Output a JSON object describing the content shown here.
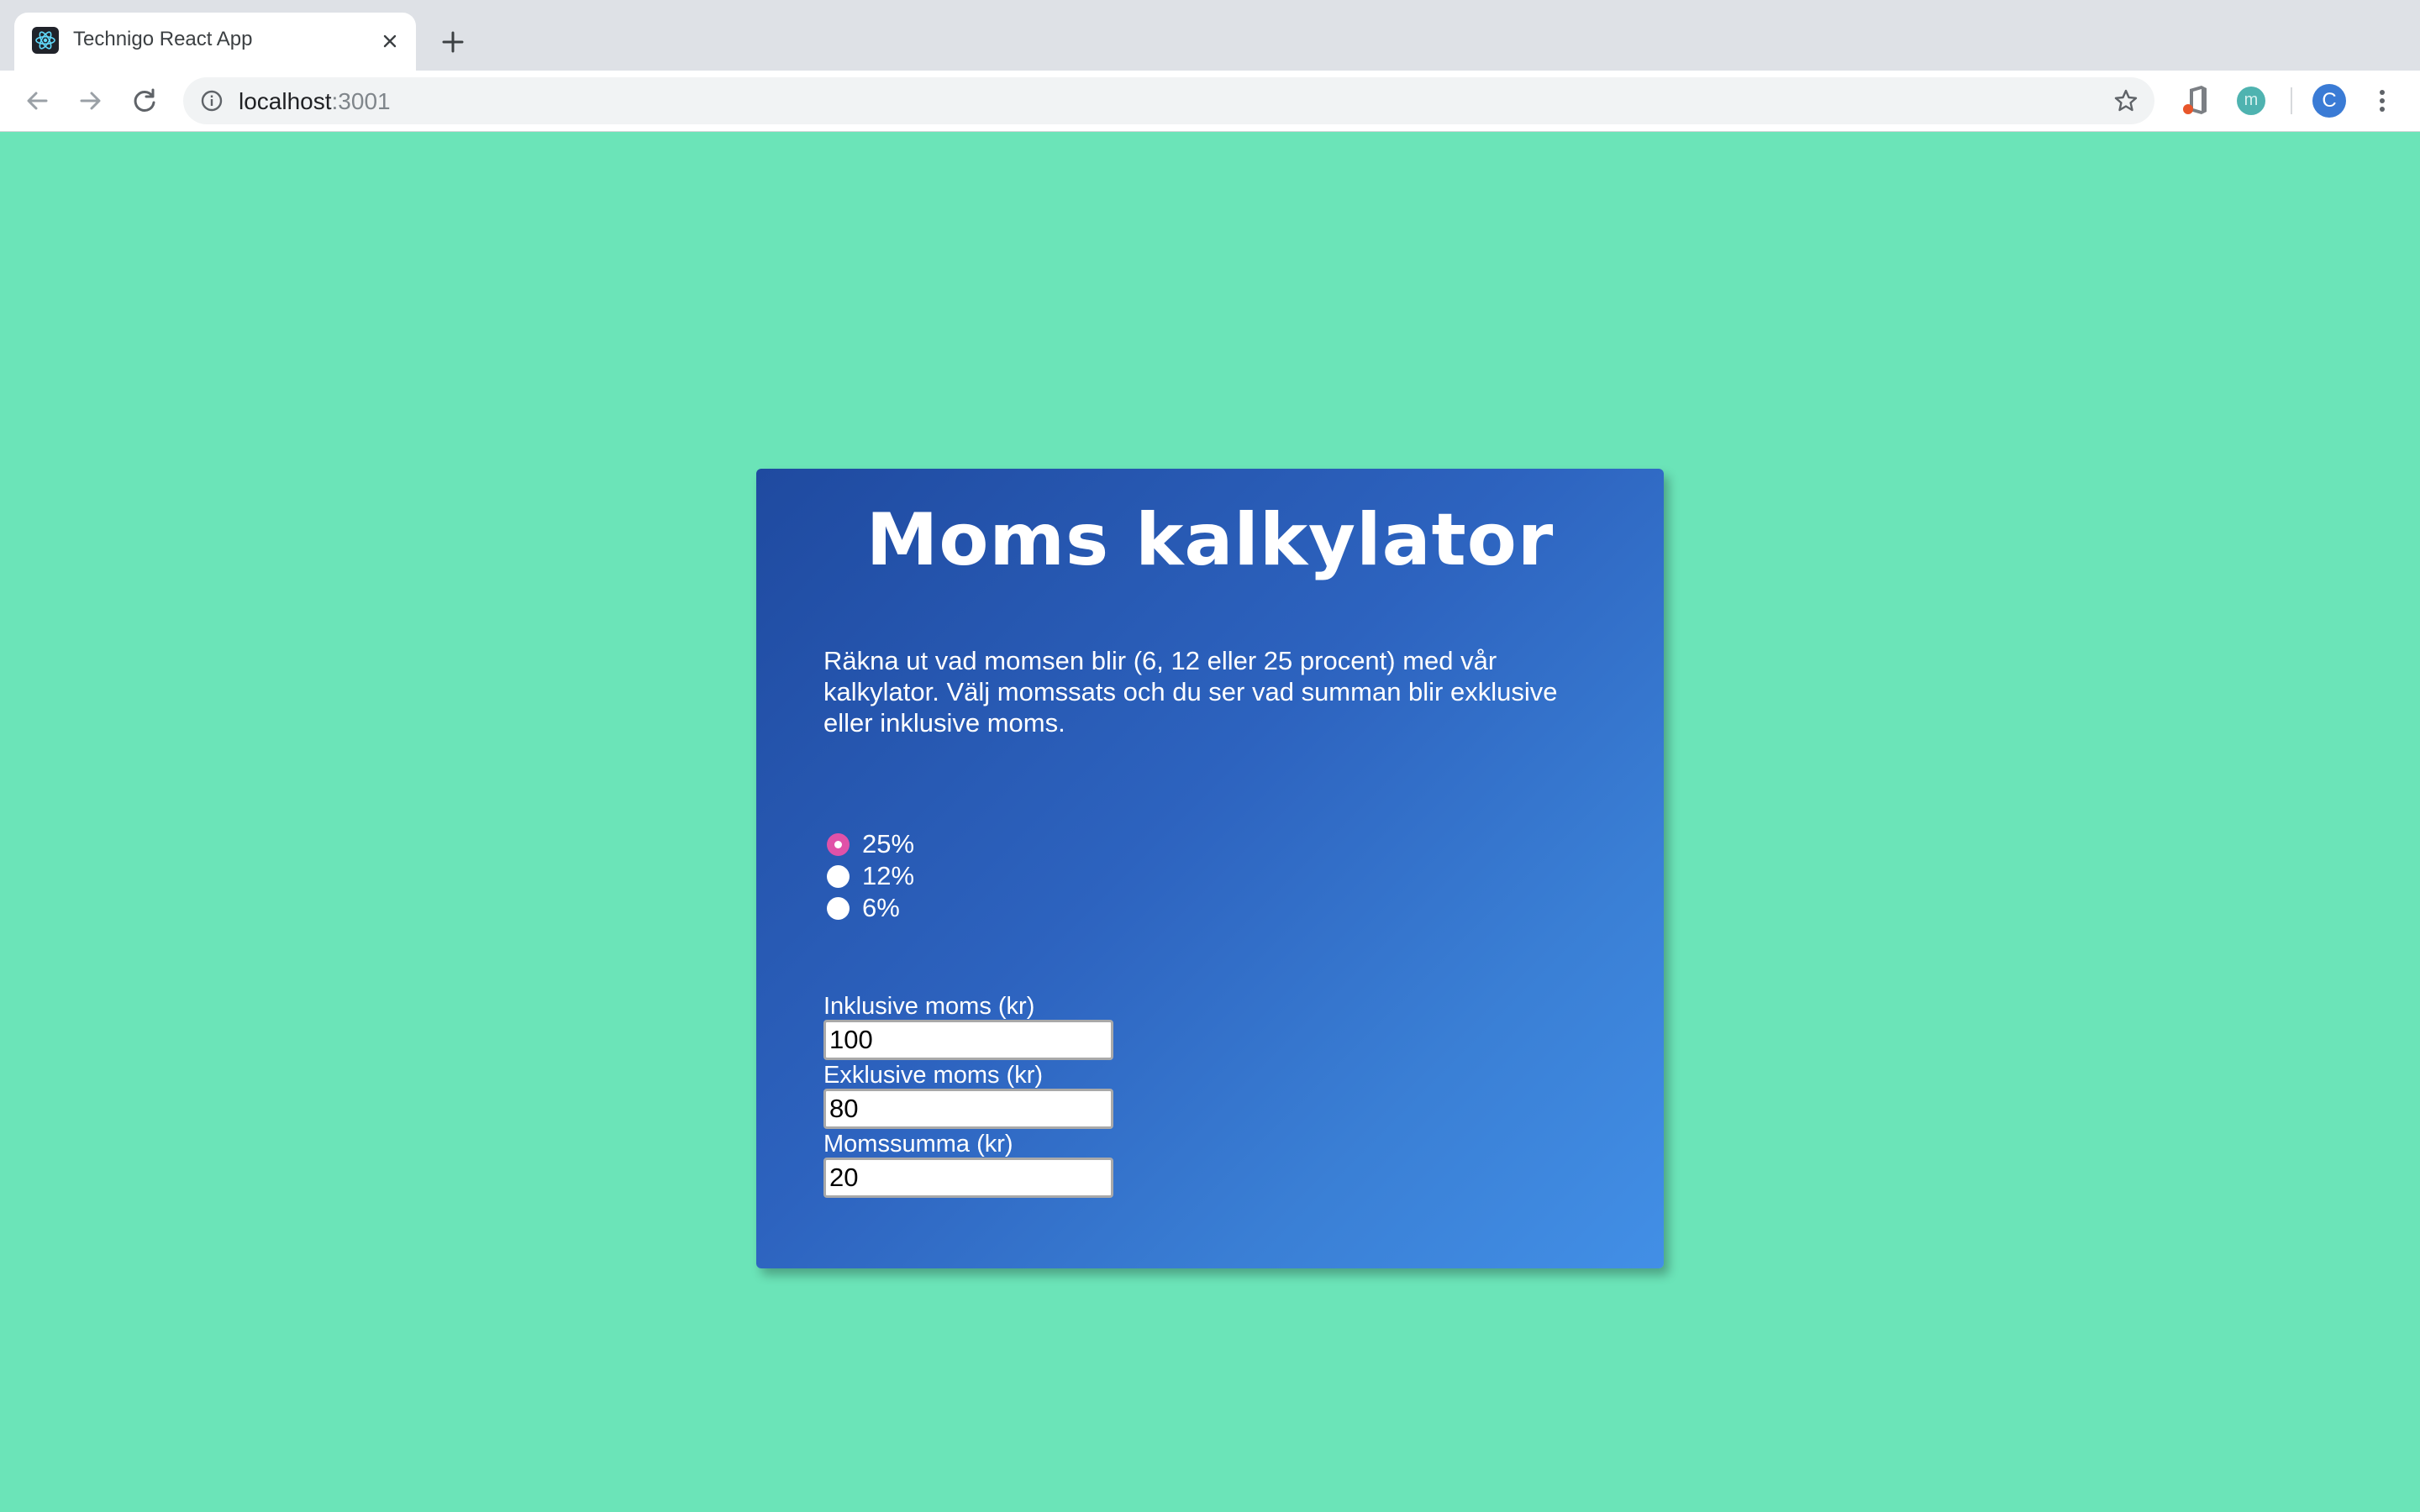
{
  "browser": {
    "tab": {
      "title": "Technigo React App"
    },
    "omnibox": {
      "host": "localhost",
      "port": ":3001"
    },
    "profile_initial": "C",
    "extension_m_label": "m"
  },
  "calculator": {
    "title": "Moms kalkylator",
    "description": "Räkna ut vad momsen blir (6, 12 eller 25 procent) med vår kalkylator. Välj momssats och du ser vad summan blir exklusive eller inklusive moms.",
    "rates": [
      {
        "label": "25%",
        "checked": true
      },
      {
        "label": "12%",
        "checked": false
      },
      {
        "label": "6%",
        "checked": false
      }
    ],
    "fields": {
      "inclusive": {
        "label": "Inklusive moms (kr)",
        "value": "100"
      },
      "exclusive": {
        "label": "Exklusive moms (kr)",
        "value": "80"
      },
      "vat_amount": {
        "label": "Momssumma (kr)",
        "value": "20"
      }
    }
  },
  "colors": {
    "page_background": "#6be4b8",
    "card_gradient_start": "#1f4aa0",
    "card_gradient_end": "#428fe6",
    "radio_checked": "#e052a8"
  }
}
